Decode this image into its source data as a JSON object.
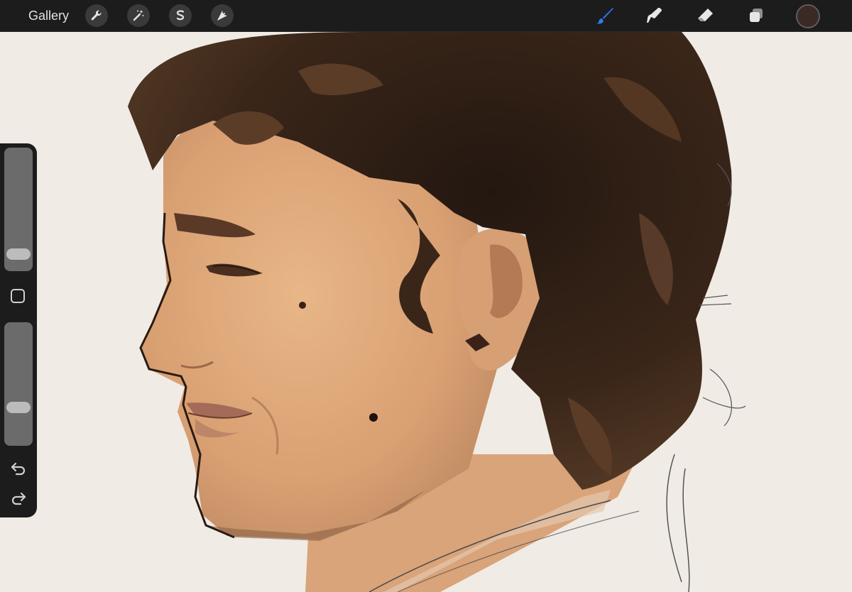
{
  "toolbar": {
    "gallery_label": "Gallery",
    "left_tools": [
      {
        "name": "actions-wrench",
        "icon": "wrench-icon"
      },
      {
        "name": "adjustments",
        "icon": "magic-wand-icon"
      },
      {
        "name": "selection",
        "icon": "selection-s-icon"
      },
      {
        "name": "transform",
        "icon": "arrow-cursor-icon"
      }
    ],
    "right_tools": [
      {
        "name": "brush",
        "icon": "brush-icon",
        "active": true
      },
      {
        "name": "smudge",
        "icon": "smudge-finger-icon",
        "active": false
      },
      {
        "name": "eraser",
        "icon": "eraser-icon",
        "active": false
      },
      {
        "name": "layers",
        "icon": "layers-icon",
        "active": false
      }
    ],
    "current_color": "#3b2a24",
    "active_color": "#2f7cf6"
  },
  "sidebar": {
    "brush_size_level": 0.08,
    "brush_opacity_level": 0.28,
    "icons": [
      "modify-square-icon",
      "undo-icon",
      "redo-icon"
    ]
  },
  "colors": {
    "canvas_bg": "#f0ebe5",
    "skin": "#dfa97a",
    "hair": "#2a1b13",
    "chrome": "#1d1c1c"
  }
}
